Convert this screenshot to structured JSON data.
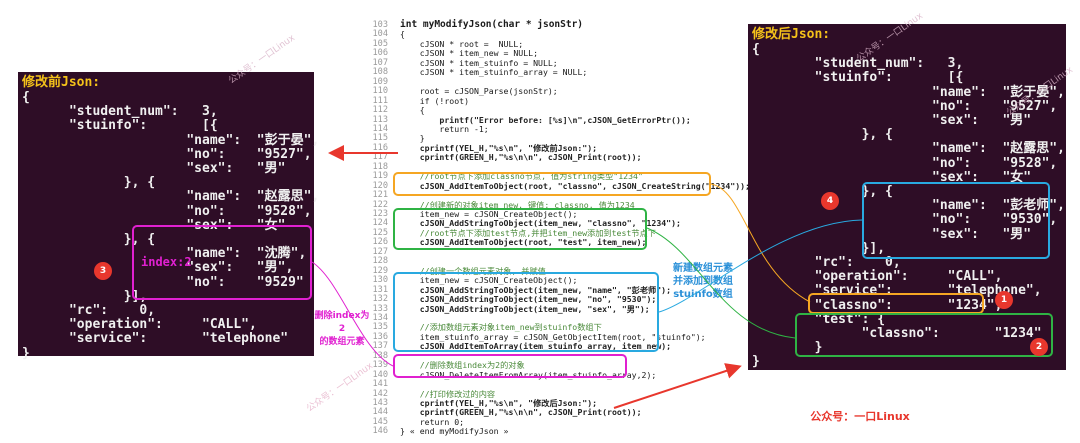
{
  "left_panel": {
    "title": "修改前Json:",
    "lines": [
      "{",
      "      \"student_num\":   3,",
      "      \"stuinfo\":       [{",
      "                     \"name\":  \"彭于晏\",",
      "                     \"no\":    \"9527\",",
      "                     \"sex\":   \"男\"",
      "             }, {",
      "                     \"name\":  \"赵露思\",",
      "                     \"no\":    \"9528\",",
      "                     \"sex\":   \"女\"",
      "             }, {",
      "                     \"name\":  \"沈腾\",",
      "                     \"sex\":   \"男\",",
      "                     \"no\":    \"9529\"",
      "             }],",
      "      \"rc\":    0,",
      "      \"operation\":     \"CALL\",",
      "      \"service\":       \"telephone\"",
      "}"
    ],
    "index_label": "index:2",
    "badge": "3"
  },
  "right_panel": {
    "title": "修改后Json:",
    "lines": [
      "{",
      "        \"student_num\":   3,",
      "        \"stuinfo\":       [{",
      "                       \"name\":  \"彭于晏\",",
      "                       \"no\":    \"9527\",",
      "                       \"sex\":   \"男\"",
      "              }, {",
      "                       \"name\":  \"赵露思\",",
      "                       \"no\":    \"9528\",",
      "                       \"sex\":   \"女\"",
      "              }, {",
      "                       \"name\":  \"彭老师\",",
      "                       \"no\":    \"9530\",",
      "                       \"sex\":   \"男\"",
      "              }],",
      "        \"rc\":    0,",
      "        \"operation\":     \"CALL\",",
      "        \"service\":       \"telephone\",",
      "        \"classno\":       \"1234\",",
      "        \"test\": {",
      "              \"classno\":       \"1234\"",
      "        }",
      "}"
    ],
    "badges": [
      "4",
      "1",
      "2"
    ]
  },
  "code": {
    "line_numbers": [
      "103",
      "104",
      "105",
      "106",
      "107",
      "108",
      "109",
      "110",
      "111",
      "112",
      "113",
      "114",
      "115",
      "116",
      "117",
      "118",
      "119",
      "120",
      "121",
      "122",
      "123",
      "124",
      "125",
      "126",
      "127",
      "128",
      "129",
      "130",
      "131",
      "132",
      "133",
      "134",
      "135",
      "136",
      "137",
      "138",
      "139",
      "140",
      "141",
      "142",
      "143",
      "144",
      "145",
      "146"
    ],
    "lines": [
      "int myModifyJson(char * jsonStr)",
      "{",
      "    cJSON * root =  NULL;",
      "    cJSON * item_new = NULL;",
      "    cJSON * item_stuinfo = NULL;",
      "    cJSON * item_stuinfo_array = NULL;",
      "",
      "    root = cJSON_Parse(jsonStr);",
      "    if (!root)",
      "    {",
      "        printf(\"Error before: [%s]\\n\",cJSON_GetErrorPtr());",
      "        return -1;",
      "    }",
      "    cprintf(YEL_H,\"%s\\n\", \"修改前Json:\");",
      "    cprintf(GREEN_H,\"%s\\n\\n\", cJSON_Print(root));",
      "",
      "    //root节点下添加classno节点, 值为string类型\"1234\"",
      "    cJSON_AddItemToObject(root, \"classno\", cJSON_CreateString(\"1234\"));",
      "",
      "    //创建新的对象item_new, 键值: classno, 值为1234",
      "    item_new = cJSON_CreateObject();",
      "    cJSON_AddStringToObject(item_new, \"classno\", \"1234\");",
      "    //root节点下添加test节点,并把item_new添加到test节点下",
      "    cJSON_AddItemToObject(root, \"test\", item_new);",
      "",
      "",
      "    //创建一个数组元素对象, 并赋值",
      "    item_new = cJSON_CreateObject();",
      "    cJSON_AddStringToObject(item_new, \"name\", \"彭老师\");",
      "    cJSON_AddStringToObject(item_new, \"no\", \"9530\");",
      "    cJSON_AddStringToObject(item_new, \"sex\", \"男\");",
      "",
      "    //添加数组元素对象item_new到stuinfo数组下",
      "    item_stuinfo_array = cJSON_GetObjectItem(root, \"stuinfo\");",
      "    cJSON_AddItemToArray(item_stuinfo_array, item_new);",
      "",
      "    //删除数组index为2的对象",
      "    cJSON_DeleteItemFromArray(item_stuinfo_array,2);",
      "",
      "    //打印修改过的内容",
      "    cprintf(YEL_H,\"%s\\n\", \"修改后Json:\");",
      "    cprintf(GREEN_H,\"%s\\n\\n\", cJSON_Print(root));",
      "    return 0;",
      "} « end myModifyJson »"
    ]
  },
  "annotations": {
    "new_array_note": "新建数组元素\n并添加到数组\nstuinfo数组",
    "delete_note": "删除index为2\n的数组元素",
    "footer": "公众号：一口Linux",
    "watermark": "公众号：一口Linux"
  },
  "colors": {
    "terminal_bg": "#2e0d26",
    "title": "#f5c21a",
    "orange_box": "#f5a623",
    "green_box": "#2fb344",
    "blue_box": "#29a9e0",
    "magenta_box": "#e020d0",
    "red": "#e8372d"
  }
}
